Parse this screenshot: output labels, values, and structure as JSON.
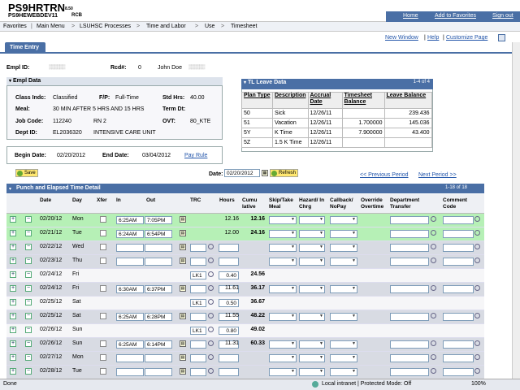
{
  "header": {
    "app_title": "PS9HRTRN",
    "app_version": "8.50",
    "db_name": "PS9HEWEBDEV11",
    "db_suffix": "RCB",
    "links": [
      "Home",
      "Add to Favorites",
      "Sign out"
    ]
  },
  "breadcrumb": [
    "Favorites",
    "Main Menu",
    "LSUHSC Processes",
    "Time and Labor",
    "Use",
    "Timesheet"
  ],
  "top_links": [
    "New Window",
    "Help",
    "Customize Page"
  ],
  "tab": "Time Entry",
  "employee": {
    "empl_id_label": "Empl ID:",
    "empl_id_masked": "▒▒▒▒▒▒",
    "rcd_label": "Rcd#:",
    "rcd_value": "0",
    "name": "John Doe",
    "name_masked": "▒▒▒▒▒▒"
  },
  "empl_data": {
    "title": "Empl Data",
    "class_label": "Class Indc:",
    "class_value": "Classified",
    "fp_label": "F/P:",
    "fp_value": "Full-Time",
    "std_label": "Std Hrs:",
    "std_value": "40.00",
    "meal_label": "Meal:",
    "meal_value": "30 MIN AFTER 5 HRS AND 15 HRS",
    "term_label": "Term Dt:",
    "job_label": "Job Code:",
    "job_code": "112240",
    "job_name": "RN 2",
    "ovt_label": "OVT:",
    "ovt_value": "80_KTE",
    "dept_label": "Dept ID:",
    "dept_id": "EL2036320",
    "dept_name": "INTENSIVE CARE UNIT"
  },
  "leave": {
    "title": "TL Leave Data",
    "count": "1-4 of 4",
    "headers": [
      "Plan Type",
      "Description",
      "Accrual Date",
      "Timesheet Balance",
      "Leave Balance"
    ],
    "rows": [
      [
        "50",
        "Sick",
        "12/26/11",
        "",
        "239.436"
      ],
      [
        "51",
        "Vacation",
        "12/26/11",
        "1.700000",
        "145.036"
      ],
      [
        "5Y",
        "K Time",
        "12/26/11",
        "7.900000",
        "43.400"
      ],
      [
        "5Z",
        "1.5 K Time",
        "12/26/11",
        "",
        ""
      ]
    ]
  },
  "dates": {
    "begin_label": "Begin Date:",
    "begin_value": "02/20/2012",
    "end_label": "End Date:",
    "end_value": "03/04/2012",
    "pay_rule": "Pay Rule"
  },
  "toolbar": {
    "save_label": "Save",
    "date_label": "Date:",
    "date_value": "02/20/2012",
    "refresh_label": "Refresh",
    "prev_period": "<< Previous Period",
    "next_period": "Next Period >>"
  },
  "grid": {
    "title": "Punch and Elapsed Time Detail",
    "count": "1-18 of 18",
    "headers": {
      "date": "Date",
      "day": "Day",
      "xfer": "Xfer",
      "in": "In",
      "out": "Out",
      "trc": "TRC",
      "hours": "Hours",
      "cumu": "Cumu lative",
      "skip": "Skip/Take Meal",
      "hazard": "Hazard/ In Chrg",
      "callback": "Callback/ NoPay",
      "override": "Override Overtime",
      "dept_transfer": "Department Transfer",
      "comment": "Comment Code"
    },
    "rows": [
      {
        "date": "02/20/12",
        "day": "Mon",
        "in": "6:25AM",
        "out": "7:05PM",
        "trc": "",
        "hours": "12.16",
        "cumu": "12.16",
        "style": "green",
        "xfer": true
      },
      {
        "date": "02/21/12",
        "day": "Tue",
        "in": "6:24AM",
        "out": "6:54PM",
        "trc": "",
        "hours": "12.00",
        "cumu": "24.16",
        "style": "green",
        "xfer": true
      },
      {
        "date": "02/22/12",
        "day": "Wed",
        "in": "",
        "out": "",
        "trc": "",
        "hours": "",
        "cumu": "",
        "style": "grey",
        "xfer": true
      },
      {
        "date": "02/23/12",
        "day": "Thu",
        "in": "",
        "out": "",
        "trc": "",
        "hours": "",
        "cumu": "",
        "style": "grey",
        "xfer": true
      },
      {
        "date": "02/24/12",
        "day": "Fri",
        "in": "",
        "out": "",
        "trc": "LK1",
        "hours": "0.40",
        "cumu": "24.56",
        "style": "white",
        "xfer": false
      },
      {
        "date": "02/24/12",
        "day": "Fri",
        "in": "6:30AM",
        "out": "6:37PM",
        "trc": "",
        "hours": "11.61",
        "cumu": "36.17",
        "style": "grey",
        "xfer": true
      },
      {
        "date": "02/25/12",
        "day": "Sat",
        "in": "",
        "out": "",
        "trc": "LK1",
        "hours": "0.50",
        "cumu": "36.67",
        "style": "white",
        "xfer": false
      },
      {
        "date": "02/25/12",
        "day": "Sat",
        "in": "6:25AM",
        "out": "6:28PM",
        "trc": "",
        "hours": "11.55",
        "cumu": "48.22",
        "style": "grey",
        "xfer": true
      },
      {
        "date": "02/26/12",
        "day": "Sun",
        "in": "",
        "out": "",
        "trc": "LK1",
        "hours": "0.80",
        "cumu": "49.02",
        "style": "white",
        "xfer": false
      },
      {
        "date": "02/26/12",
        "day": "Sun",
        "in": "6:25AM",
        "out": "6:14PM",
        "trc": "",
        "hours": "11.31",
        "cumu": "60.33",
        "style": "grey",
        "xfer": true
      },
      {
        "date": "02/27/12",
        "day": "Mon",
        "in": "",
        "out": "",
        "trc": "",
        "hours": "",
        "cumu": "",
        "style": "grey",
        "xfer": true
      },
      {
        "date": "02/28/12",
        "day": "Tue",
        "in": "",
        "out": "",
        "trc": "",
        "hours": "",
        "cumu": "",
        "style": "grey",
        "xfer": true
      }
    ]
  },
  "status": {
    "left": "Done",
    "zone": "Local intranet | Protected Mode: Off",
    "zoom": "100%"
  }
}
